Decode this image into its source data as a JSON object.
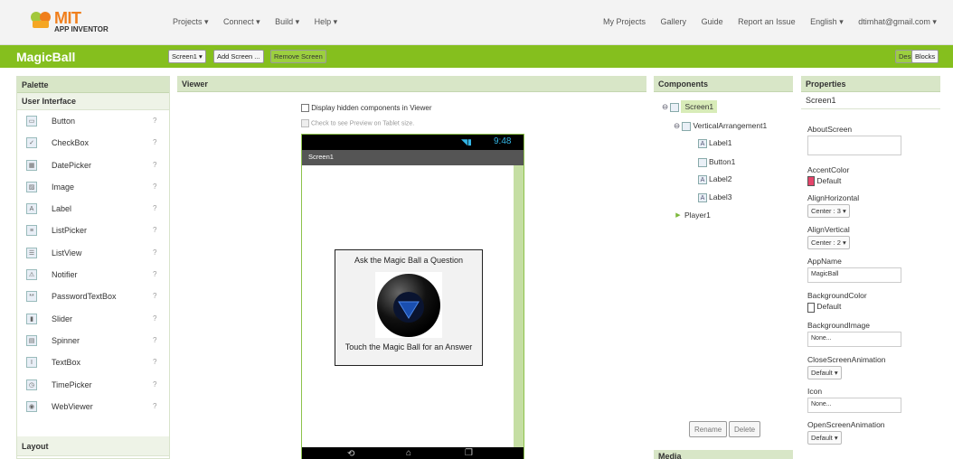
{
  "header": {
    "logo_mit": "MIT",
    "logo_app": "APP INVENTOR",
    "menus": [
      "Projects ▾",
      "Connect ▾",
      "Build ▾",
      "Help ▾"
    ],
    "right_links": [
      "My Projects",
      "Gallery",
      "Guide",
      "Report an Issue",
      "English ▾",
      "dtimhat@gmail.com ▾"
    ]
  },
  "project": {
    "name": "MagicBall",
    "screen_select": "Screen1 ▾",
    "add_screen": "Add Screen ...",
    "remove_screen": "Remove Screen",
    "designer": "Designer",
    "blocks": "Blocks"
  },
  "palette": {
    "title": "Palette",
    "section": "User Interface",
    "items": [
      {
        "label": "Button",
        "icon": "button-icon"
      },
      {
        "label": "CheckBox",
        "icon": "checkbox-icon"
      },
      {
        "label": "DatePicker",
        "icon": "datepicker-icon"
      },
      {
        "label": "Image",
        "icon": "image-icon"
      },
      {
        "label": "Label",
        "icon": "label-icon"
      },
      {
        "label": "ListPicker",
        "icon": "listpicker-icon"
      },
      {
        "label": "ListView",
        "icon": "listview-icon"
      },
      {
        "label": "Notifier",
        "icon": "notifier-icon"
      },
      {
        "label": "PasswordTextBox",
        "icon": "password-icon"
      },
      {
        "label": "Slider",
        "icon": "slider-icon"
      },
      {
        "label": "Spinner",
        "icon": "spinner-icon"
      },
      {
        "label": "TextBox",
        "icon": "textbox-icon"
      },
      {
        "label": "TimePicker",
        "icon": "timepicker-icon"
      },
      {
        "label": "WebViewer",
        "icon": "webviewer-icon"
      }
    ],
    "help_glyph": "?",
    "layout_section": "Layout"
  },
  "viewer": {
    "title": "Viewer",
    "hidden_checkbox": "Display hidden components in Viewer",
    "tablet_checkbox": "Check to see Preview on Tablet size.",
    "time": "9:48",
    "screen_title": "Screen1",
    "label1": "Ask the Magic Ball a Question",
    "label2": "Touch the Magic Ball for an Answer"
  },
  "components": {
    "title": "Components",
    "tree": [
      {
        "label": "Screen1",
        "level": 0
      },
      {
        "label": "VerticalArrangement1",
        "level": 1
      },
      {
        "label": "Label1",
        "level": 2
      },
      {
        "label": "Button1",
        "level": 2
      },
      {
        "label": "Label2",
        "level": 2
      },
      {
        "label": "Label3",
        "level": 2
      },
      {
        "label": "Player1",
        "level": 1
      }
    ],
    "rename": "Rename",
    "delete": "Delete",
    "media_title": "Media"
  },
  "properties": {
    "title": "Properties",
    "component": "Screen1",
    "about_screen": "AboutScreen",
    "accent_color": "AccentColor",
    "accent_value": "Default",
    "accent_swatch": "#e5456b",
    "align_horizontal": "AlignHorizontal",
    "align_horizontal_value": "Center : 3 ▾",
    "align_vertical": "AlignVertical",
    "align_vertical_value": "Center : 2 ▾",
    "app_name": "AppName",
    "app_name_value": "MagicBall",
    "background_color": "BackgroundColor",
    "background_value": "Default",
    "background_image": "BackgroundImage",
    "background_image_value": "None...",
    "close_anim": "CloseScreenAnimation",
    "close_anim_value": "Default ▾",
    "icon": "Icon",
    "icon_value": "None...",
    "open_anim": "OpenScreenAnimation",
    "open_anim_value": "Default ▾"
  },
  "colors": {
    "green": "#85bf1e",
    "panel_head": "#d8e6c7"
  }
}
